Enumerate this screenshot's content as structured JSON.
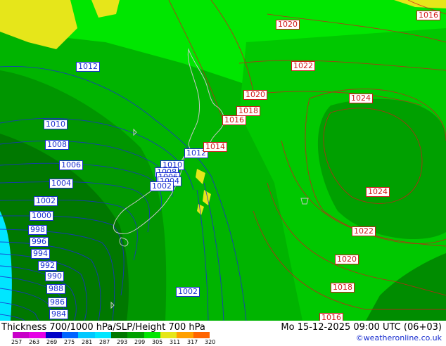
{
  "map": {
    "blue_labels": [
      "1012",
      "1010",
      "1008",
      "1006",
      "1004",
      "1002",
      "1000",
      "998",
      "996",
      "994",
      "992",
      "990",
      "988",
      "986",
      "984",
      "1012",
      "1010",
      "1008",
      "1006",
      "1004",
      "1002",
      "1002"
    ],
    "red_labels": [
      "1016",
      "1020",
      "1022",
      "1020",
      "1018",
      "1016",
      "1014",
      "1024",
      "1024",
      "1022",
      "1020",
      "1018",
      "1016"
    ]
  },
  "footer": {
    "title": "Thickness 700/1000 hPa/SLP/Height 700 hPa",
    "datetime": "Mo 15-12-2025 09:00 UTC (06+03)",
    "credit": "©weatheronline.co.uk",
    "scale_ticks": [
      "257",
      "263",
      "269",
      "275",
      "281",
      "287",
      "293",
      "299",
      "305",
      "311",
      "317",
      "320"
    ]
  },
  "colors": {
    "yellow": "#e6e61a",
    "green_bright": "#00e600",
    "green_mid": "#00c800",
    "green_dark": "#009600",
    "green_darker": "#007800",
    "cyan": "#00e6ff",
    "isobar": "#1a2fd0",
    "height": "#d01a1a"
  }
}
